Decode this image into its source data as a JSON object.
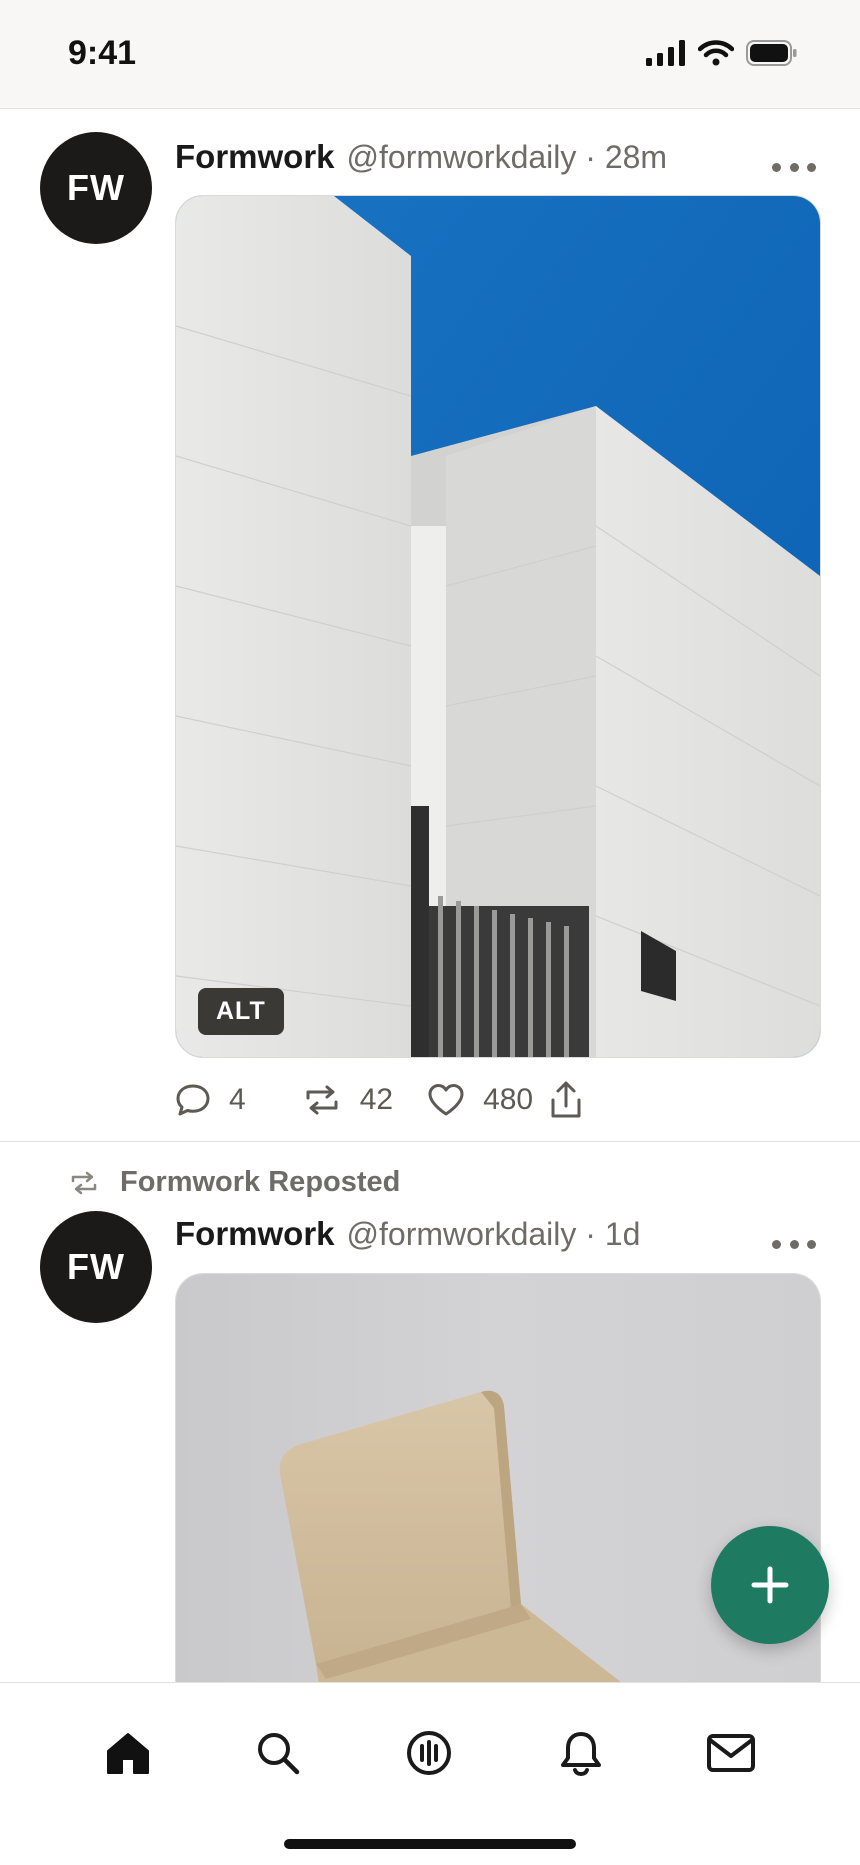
{
  "status_bar": {
    "time": "9:41"
  },
  "posts": [
    {
      "avatar_initials": "FW",
      "display_name": "Formwork",
      "handle_time": "@formworkdaily · 28m",
      "media_badge": "ALT",
      "actions": {
        "replies": "4",
        "reposts": "42",
        "likes": "480"
      }
    },
    {
      "repost_label": "Formwork Reposted",
      "avatar_initials": "FW",
      "display_name": "Formwork",
      "handle_time": "@formworkdaily · 1d"
    }
  ],
  "colors": {
    "accent": "#1f7a62",
    "avatar_bg": "#1c1a18",
    "sky_blue": "#0f6cbf",
    "muted_text": "#6f6b66"
  },
  "icons": {
    "tabs": [
      "home-icon",
      "search-icon",
      "feeds-icon",
      "bell-icon",
      "mail-icon"
    ],
    "fab": "plus-icon"
  }
}
